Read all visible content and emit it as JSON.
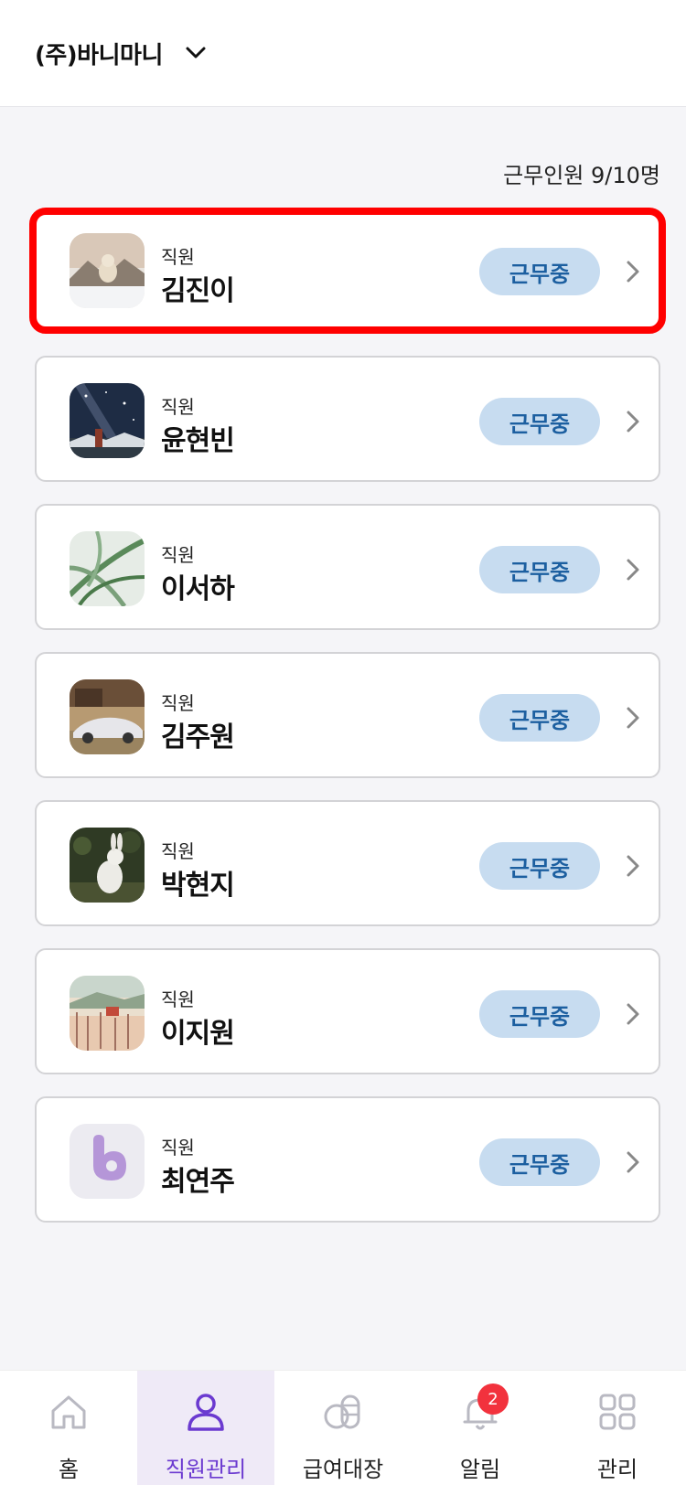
{
  "header": {
    "company": "(주)바니마니"
  },
  "summary": {
    "working_count": "근무인원 9/10명"
  },
  "employees": [
    {
      "role": "직원",
      "name": "김진이",
      "status": "근무중"
    },
    {
      "role": "직원",
      "name": "윤현빈",
      "status": "근무중"
    },
    {
      "role": "직원",
      "name": "이서하",
      "status": "근무중"
    },
    {
      "role": "직원",
      "name": "김주원",
      "status": "근무중"
    },
    {
      "role": "직원",
      "name": "박현지",
      "status": "근무중"
    },
    {
      "role": "직원",
      "name": "이지원",
      "status": "근무중"
    },
    {
      "role": "직원",
      "name": "최연주",
      "status": "근무중"
    }
  ],
  "tabs": [
    {
      "label": "홈",
      "icon": "home-icon"
    },
    {
      "label": "직원관리",
      "icon": "person-icon"
    },
    {
      "label": "급여대장",
      "icon": "coins-icon"
    },
    {
      "label": "알림",
      "icon": "bell-icon",
      "badge": "2"
    },
    {
      "label": "관리",
      "icon": "grid-icon"
    }
  ],
  "colors": {
    "accent": "#6b3ad0",
    "badge_bg": "#c7dcf0",
    "badge_text": "#1c5fa0",
    "highlight": "#ff0000"
  }
}
